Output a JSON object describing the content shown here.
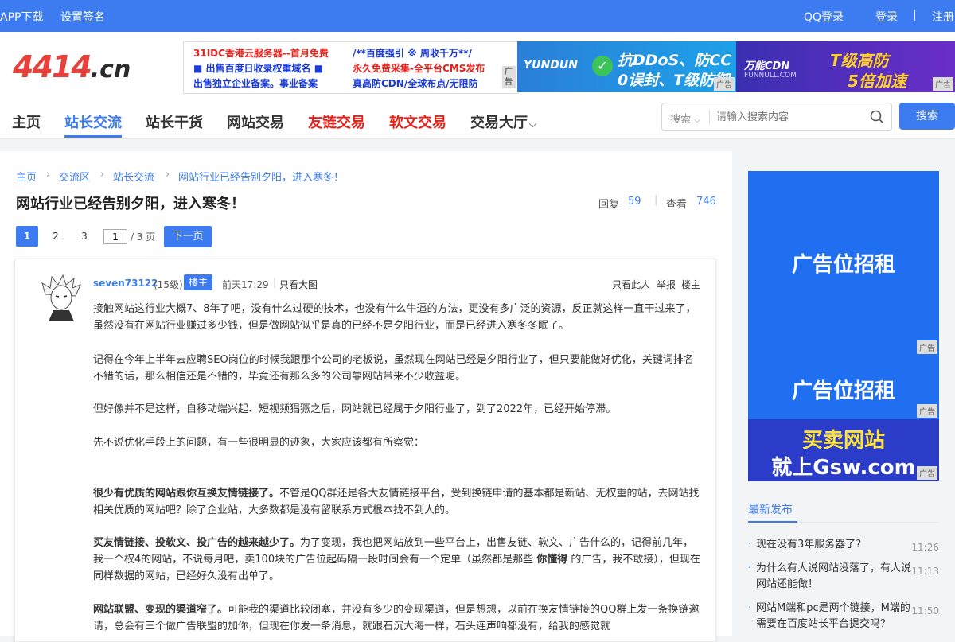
{
  "topbar": {
    "app": "APP下载",
    "sign": "设置签名",
    "qq": "QQ登录",
    "login": "登录",
    "sep": "|",
    "register": "注册"
  },
  "logo": {
    "main": "4414",
    "tld": ".cn"
  },
  "ad_text": {
    "c1": [
      "31IDC香港云服务器--首月免费",
      "■ 出售百度日收录权重域名 ■",
      "出售独立企业备案。事业备案"
    ],
    "c2": [
      "/**百度强引 ※ 周收千万**/",
      "永久免费采集-全平台CMS发布",
      "真高防CDN/全球布点/无限防"
    ],
    "tag": "广告"
  },
  "banner1": {
    "brand": "YUNDUN",
    "l1": "抗DDoS、防CC",
    "l2": "0误封、T级防御",
    "tag": "广告"
  },
  "banner2": {
    "brand": "万能CDN",
    "sub": "FUNNULL.COM",
    "l1": "T级高防",
    "l2": "5倍加速",
    "tag": "广告"
  },
  "nav": {
    "home": "主页",
    "exchange": "站长交流",
    "tips": "站长干货",
    "trade": "网站交易",
    "links": "友链交易",
    "articles": "软文交易",
    "hall": "交易大厅",
    "chevron": "⌵"
  },
  "search": {
    "scope": "搜索",
    "placeholder": "请输入搜索内容",
    "button": "搜索"
  },
  "breadcrumb": {
    "b1": "主页",
    "b2": "交流区",
    "b3": "站长交流",
    "b4": "网站行业已经告别夕阳，进入寒冬！",
    "sep": "›"
  },
  "thread": {
    "title": "网站行业已经告别夕阳，进入寒冬！",
    "reply_label": "回复",
    "reply_count": "59",
    "view_label": "查看",
    "view_count": "746"
  },
  "pagination": {
    "p1": "1",
    "p2": "2",
    "p3": "3",
    "current": "1",
    "total": "/ 3 页",
    "next": "下一页"
  },
  "post": {
    "author": "seven73122",
    "level": "(15级)",
    "badge": "楼主",
    "time": "前天17:29",
    "divider": "|",
    "big_image": "只看大图",
    "only_author": "只看此人",
    "report": "举报",
    "floor": "楼主",
    "p1": "接触网站这行业大概7、8年了吧，没有什么过硬的技术，也没有什么牛逼的方法，更没有多广泛的资源，反正就这样一直干过来了，虽然没有在网站行业赚过多少钱，但是做网站似乎是真的已经不是夕阳行业，而是已经进入寒冬冬眠了。",
    "p2": "记得在今年上半年去应聘SEO岗位的时候我跟那个公司的老板说，虽然现在网站已经是夕阳行业了，但只要能做好优化，关键词排名不错的话，那么相信还是不错的，毕竟还有那么多的公司靠网站带来不少收益呢。",
    "p3": "但好像并不是这样，自移动端兴起、短视频猖獗之后，网站就已经属于夕阳行业了，到了2022年，已经开始停滞。",
    "p4": "先不说优化手段上的问题，有一些很明显的迹象，大家应该都有所察觉：",
    "p5_bold": "很少有优质的网站跟你互换友情链接了。",
    "p5": "不管是QQ群还是各大友情链接平台，受到换链申请的基本都是新站、无权重的站，去网站找相关优质的网站吧？除了企业站，大多数都是没有留联系方式根本找不到人的。",
    "p6_bold": "买友情链接、投软文、投广告的越来越少了。",
    "p6a": "为了变现，我也把网站放到一些平台上，出售友链、软文、广告什么的，记得前几年，我一个权4的网站，不说每月吧，卖100块的广告位起码隔一段时间会有一个定单（虽然都是那些",
    "p6_mid": "你懂得",
    "p6b": "的广告，我不敢接），但现在同样数据的网站，已经好久没有出单了。",
    "p7_bold": "网站联盟、变现的渠道窄了。",
    "p7": "可能我的渠道比较闭塞，并没有多少的变现渠道，但是想想，以前在换友情链接的QQ群上发一条换链邀请，总会有三个做广告联盟的加你，但现在你发一条消息，就跟石沉大海一样，石头连声响都没有，给我的感觉就"
  },
  "sidebar": {
    "ad1": "广告位招租",
    "ad2": "广告位招租",
    "ad3_l1": "买卖网站",
    "ad3_l2": "就上Gsw.com",
    "tag": "广告",
    "news_title": "最新发布",
    "news": [
      {
        "title": "现在没有3年服务器了?",
        "time": "11:26"
      },
      {
        "title": "为什么有人说网站没落了，有人说网站还能做！",
        "time": "11:13"
      },
      {
        "title": "网站M端和pc是两个链接，M端的需要在百度站长平台提交吗？",
        "time": "11:50"
      }
    ]
  },
  "colors": {
    "accent": "#3d7cf0",
    "red": "#e8201a"
  }
}
